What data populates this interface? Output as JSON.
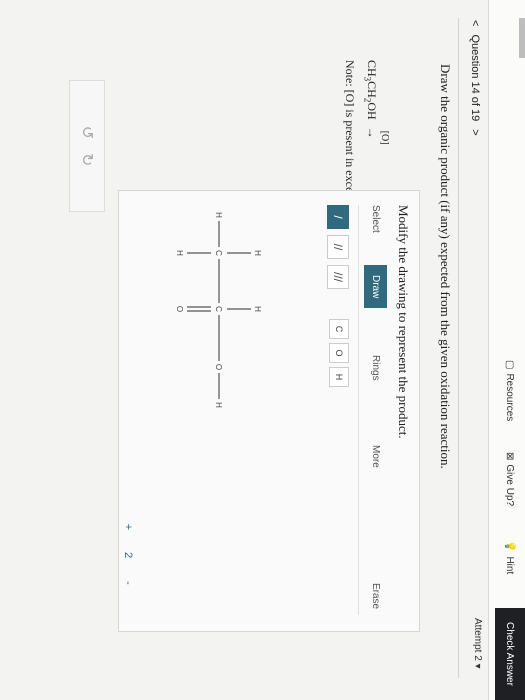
{
  "top": {
    "resources": "Resources",
    "give_up": "Give Up?",
    "hint": "Hint",
    "check_answer": "Check Answer",
    "attempt": "Attempt 2"
  },
  "question": {
    "prev": "<",
    "label": "Question 14 of 19",
    "next": ">"
  },
  "prompt": "Draw the organic product (if any) expected from the given oxidation reaction.",
  "panel": {
    "title": "Modify the drawing to represent the product.",
    "tools": {
      "select": "Select",
      "draw": "Draw",
      "rings": "Rings",
      "more": "More",
      "erase": "Erase"
    },
    "bonds": [
      "/",
      "//",
      "///"
    ],
    "atoms": [
      "C",
      "O",
      "H"
    ]
  },
  "reaction": {
    "formula": "CH3CH2OH",
    "reagent": "[O]",
    "arrow": "→",
    "note": "Note: [O] is present in excess."
  },
  "molecule": {
    "atoms": [
      {
        "id": "h1",
        "label": "H"
      },
      {
        "id": "c1",
        "label": "C"
      },
      {
        "id": "c2",
        "label": "C"
      },
      {
        "id": "o1",
        "label": "O"
      },
      {
        "id": "h2",
        "label": "H"
      },
      {
        "id": "h3",
        "label": "H"
      },
      {
        "id": "h4",
        "label": "H"
      },
      {
        "id": "h5",
        "label": "H"
      },
      {
        "id": "o2",
        "label": "O"
      }
    ]
  },
  "zoom": {
    "zoom_in": "+",
    "reset": "2",
    "zoom_out": "-"
  },
  "undo_redo": {
    "undo": "↺",
    "redo": "↻"
  },
  "colors": {
    "accent": "#2f6a7e",
    "dark": "#1f2024"
  }
}
